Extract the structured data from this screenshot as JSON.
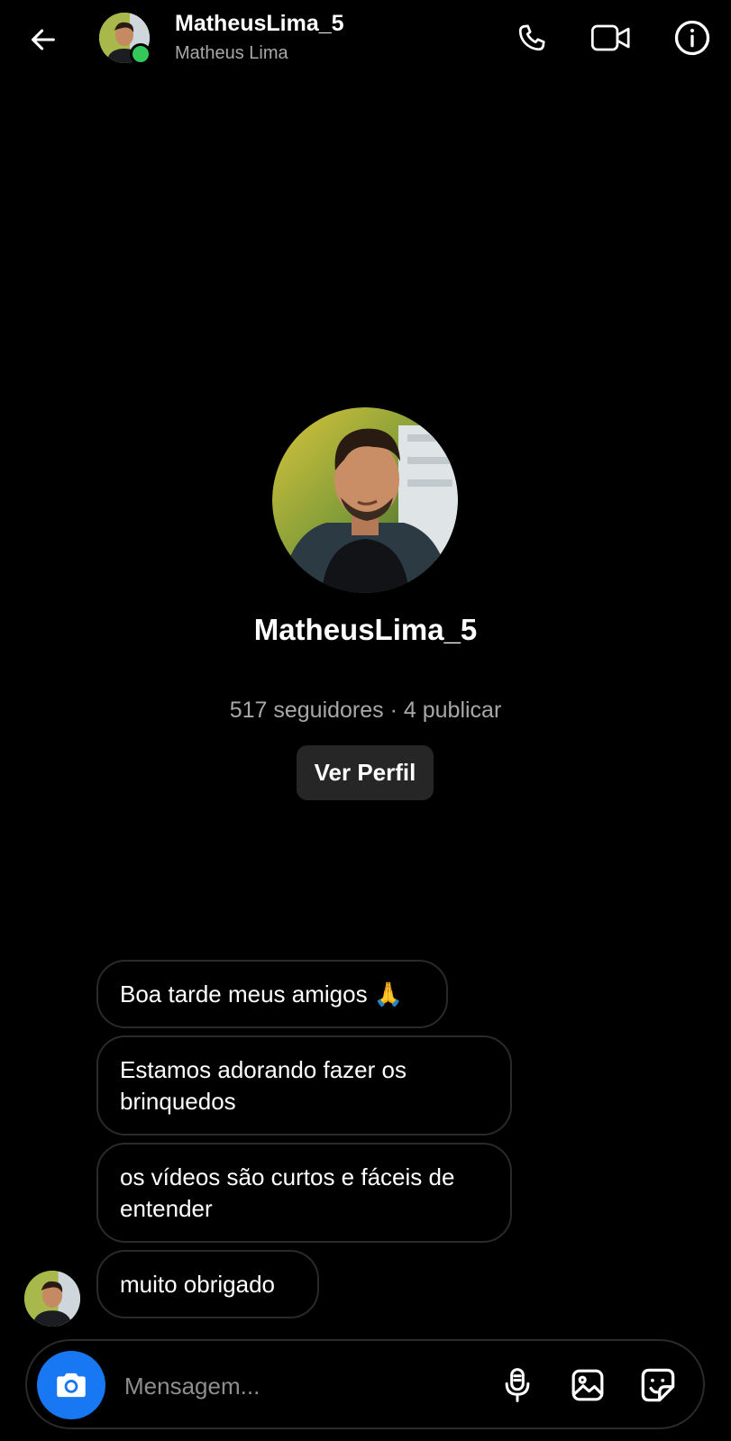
{
  "header": {
    "username": "MatheusLima_5",
    "full_name": "Matheus Lima",
    "online_color": "#34c759"
  },
  "icons": {
    "back": "arrow-left-icon",
    "call": "phone-icon",
    "video": "video-camera-icon",
    "info": "info-icon",
    "camera": "camera-icon",
    "mic": "microphone-icon",
    "gallery": "image-icon",
    "sticker": "sticker-icon"
  },
  "profile": {
    "username": "MatheusLima_5",
    "stats": "517 seguidores · 4 publicar",
    "view_profile_label": "Ver Perfil"
  },
  "messages": [
    {
      "text": "Boa tarde meus amigos 🙏"
    },
    {
      "text": "Estamos adorando fazer os brinquedos"
    },
    {
      "text": "os vídeos são curtos e fáceis de entender"
    },
    {
      "text": "muito obrigado"
    }
  ],
  "composer": {
    "placeholder": "Mensagem...",
    "camera_color": "#1877f2"
  }
}
